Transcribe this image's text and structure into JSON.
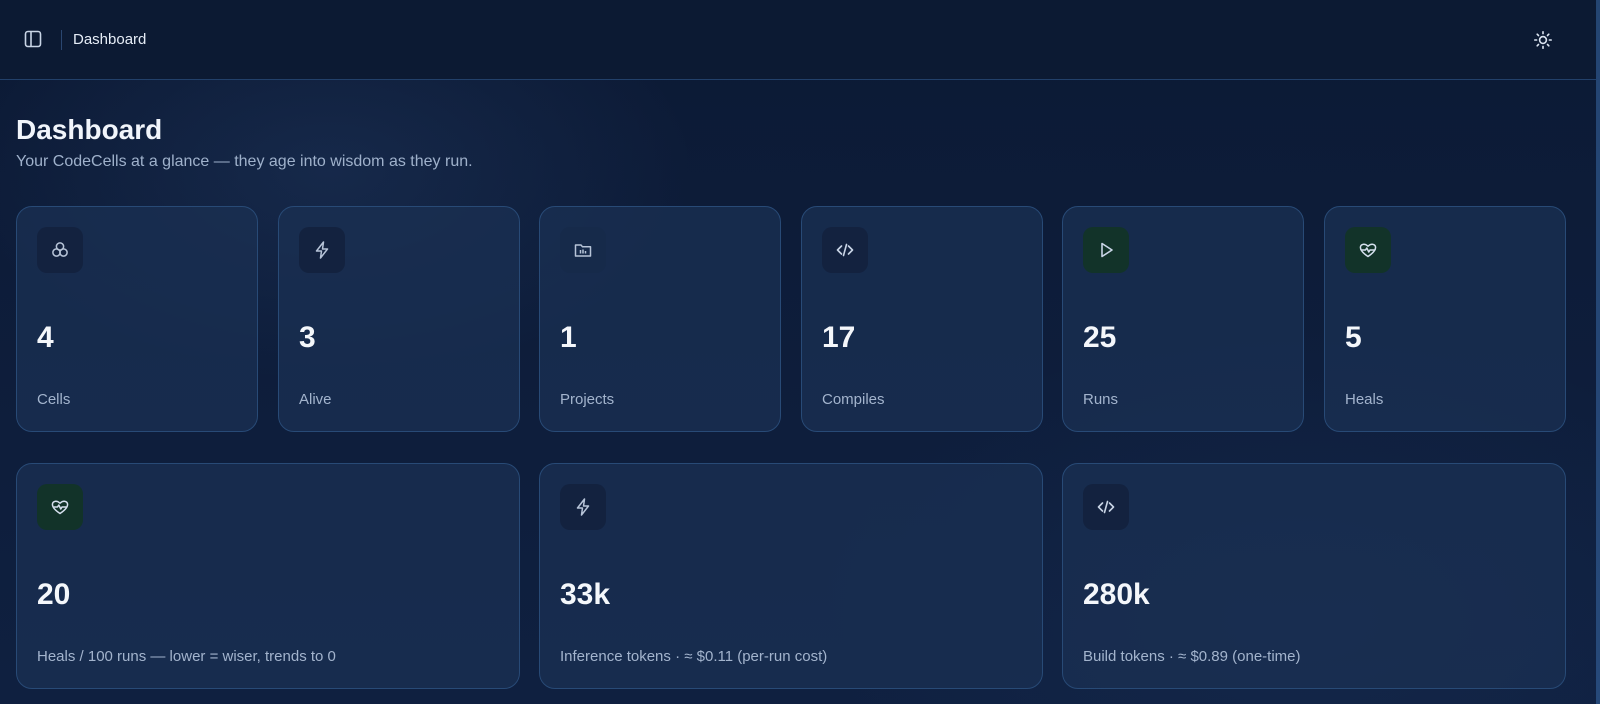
{
  "header": {
    "breadcrumb": "Dashboard",
    "sidebar_toggle_icon": "sidebar-panel-icon",
    "theme_icon": "sun-icon"
  },
  "page": {
    "title": "Dashboard",
    "subtitle": "Your CodeCells at a glance — they age into wisdom as they run."
  },
  "stats": [
    {
      "value": "4",
      "label": "Cells",
      "icon": "cells-icon"
    },
    {
      "value": "3",
      "label": "Alive",
      "icon": "lightning-icon"
    },
    {
      "value": "1",
      "label": "Projects",
      "icon": "folder-icon"
    },
    {
      "value": "17",
      "label": "Compiles",
      "icon": "code-icon"
    },
    {
      "value": "25",
      "label": "Runs",
      "icon": "play-icon"
    },
    {
      "value": "5",
      "label": "Heals",
      "icon": "heart-pulse-icon"
    }
  ],
  "metrics": [
    {
      "value": "20",
      "label": "Heals / 100 runs — lower = wiser, trends to 0",
      "icon": "heart-pulse-icon"
    },
    {
      "value": "33k",
      "label": "Inference tokens · ≈ $0.11 (per-run cost)",
      "icon": "lightning-icon"
    },
    {
      "value": "280k",
      "label": "Build tokens · ≈ $0.89 (one-time)",
      "icon": "code-icon"
    }
  ],
  "colors": {
    "background": "#0e1b36",
    "card": "#1a3052",
    "accent_green": "#123329",
    "text_muted": "#a3b4cd"
  }
}
